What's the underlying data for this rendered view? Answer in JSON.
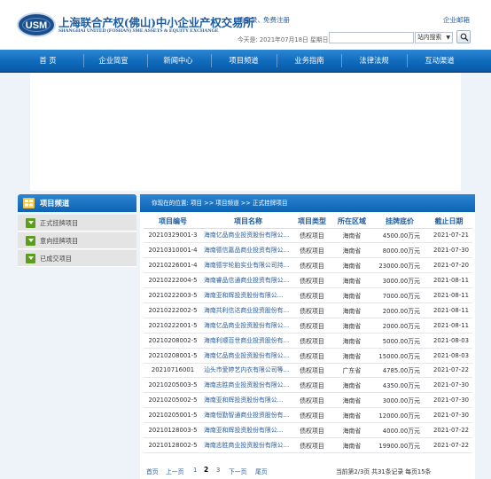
{
  "header": {
    "logo_text": "USM",
    "org_name_cn": "上海联合产权(佛山)中小企业产权交易所",
    "org_name_en": "SHANGHAI UNITED (FOSHAN) SME ASSETS & EQUITY EXCHANGE",
    "login": "请登录、",
    "register": "免费注册",
    "email": "企业邮箱",
    "today": "今天是:  2021年07月18日  星期日",
    "search_placeholder": "",
    "search_scope": "站内搜索"
  },
  "nav": [
    "首 页",
    "企业简宣",
    "新闻中心",
    "项目频道",
    "业务指南",
    "法律法规",
    "互动渠道"
  ],
  "sidebar": {
    "title": "项目频道",
    "items": [
      "正式挂牌项目",
      "意向挂牌项目",
      "已成交项目"
    ]
  },
  "main": {
    "breadcrumb": "你现在的位置:  项目 >> 项目频道 >> 正式挂牌项目",
    "columns": [
      "项目编号",
      "项目名称",
      "项目类型",
      "所在区域",
      "挂牌底价",
      "截止日期"
    ],
    "rows": [
      [
        "20210329001-3",
        "海南亿品商业投资股份有限公...",
        "债权项目",
        "海南省",
        "4500.00万元",
        "2021-07-21"
      ],
      [
        "20210310001-4",
        "海南德信嘉品商业投资有限公...",
        "债权项目",
        "海南省",
        "8000.00万元",
        "2021-07-30"
      ],
      [
        "20210226001-4",
        "海南德宇轮胎实业有限公司持...",
        "债权项目",
        "海南省",
        "23000.00万元",
        "2021-07-20"
      ],
      [
        "20210222004-5",
        "海南睿品信通商业投资有限公...",
        "债权项目",
        "海南省",
        "3000.00万元",
        "2021-08-11"
      ],
      [
        "20210222003-5",
        "海南亚和辉投资股份有限公...",
        "债权项目",
        "海南省",
        "7000.00万元",
        "2021-08-11"
      ],
      [
        "20210222002-5",
        "海南共利信达商业投资股份有...",
        "债权项目",
        "海南省",
        "2000.00万元",
        "2021-08-11"
      ],
      [
        "20210222001-5",
        "海南亿品商业投资股份有限公...",
        "债权项目",
        "海南省",
        "2000.00万元",
        "2021-08-11"
      ],
      [
        "20210208002-5",
        "海南利顺百世商业投资股份有...",
        "债权项目",
        "海南省",
        "5000.00万元",
        "2021-08-03"
      ],
      [
        "20210208001-5",
        "海南亿品商业投资股份有限公...",
        "债权项目",
        "海南省",
        "15000.00万元",
        "2021-08-03"
      ],
      [
        "20210716001",
        "汕头市爱婷艺内衣有限公司等...",
        "债权项目",
        "广东省",
        "4785.00万元",
        "2021-07-22"
      ],
      [
        "20210205003-5",
        "海南志胜商业投资股份有限公...",
        "债权项目",
        "海南省",
        "4350.00万元",
        "2021-07-30"
      ],
      [
        "20210205002-5",
        "海南亚和辉投资股份有限公...",
        "债权项目",
        "海南省",
        "3000.00万元",
        "2021-07-30"
      ],
      [
        "20210205001-5",
        "海南恒勤智通商业投资股份有...",
        "债权项目",
        "海南省",
        "12000.00万元",
        "2021-07-30"
      ],
      [
        "20210128003-5",
        "海南亚和辉投资股份有限公...",
        "债权项目",
        "海南省",
        "4000.00万元",
        "2021-07-22"
      ],
      [
        "20210128002-5",
        "海南志胜商业投资股份有限公...",
        "债权项目",
        "海南省",
        "19900.00万元",
        "2021-07-22"
      ]
    ]
  },
  "pager": {
    "first": "首页",
    "prev": "上一页",
    "pages": [
      "1",
      "2",
      "3"
    ],
    "current": "2",
    "next": "下一页",
    "last": "尾页",
    "info": "当前第2/3页 共31条记录 每页15条"
  },
  "colors": {
    "nav_blue": "#0f6bbd",
    "link_blue": "#2a5d9c",
    "sidebar_arrow_green": "#5a9e1c"
  }
}
